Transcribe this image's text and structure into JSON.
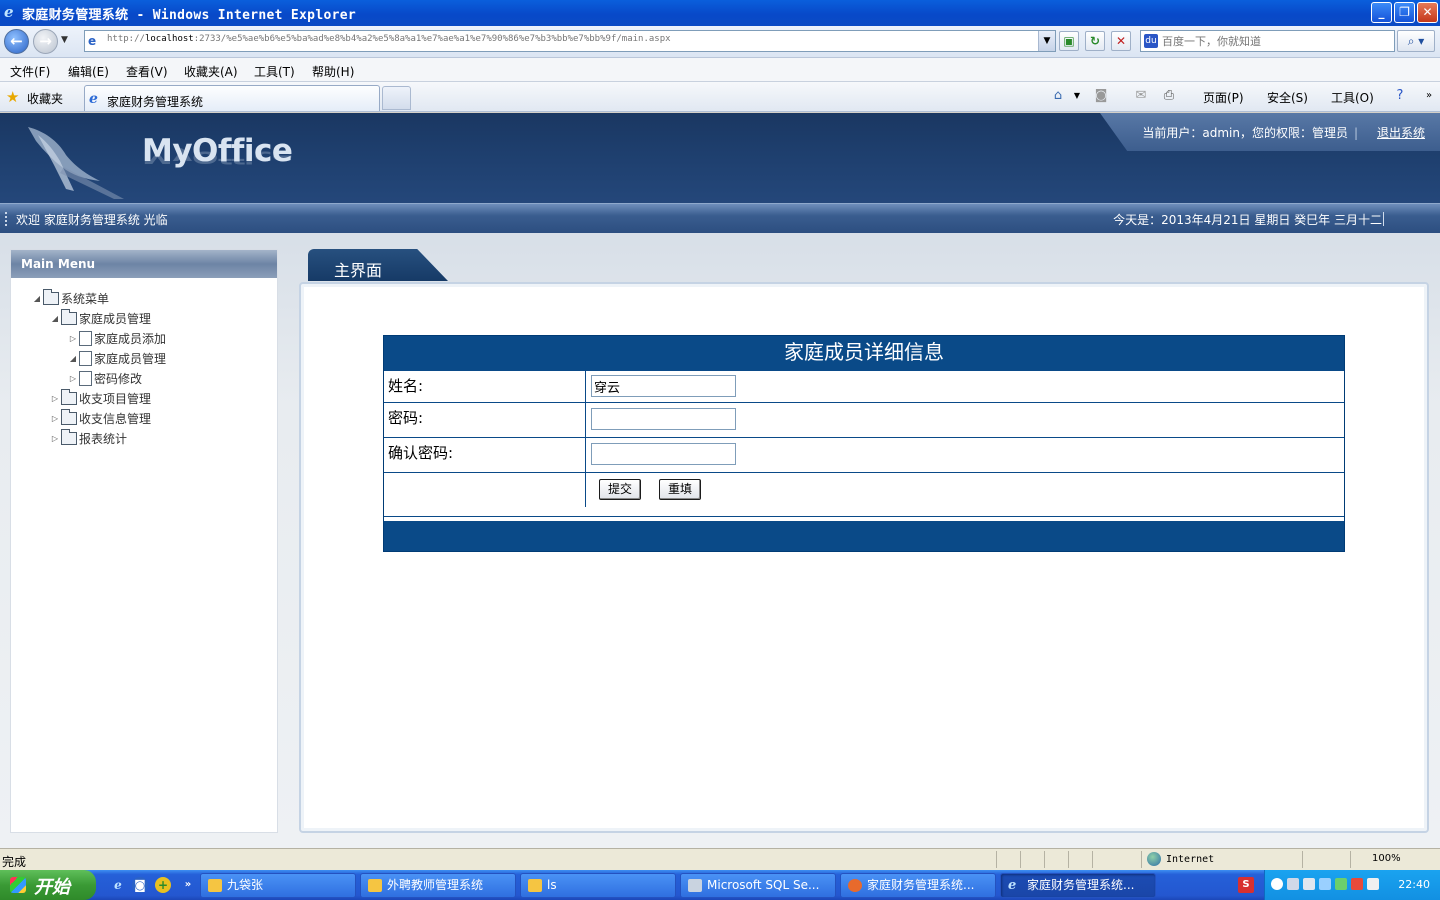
{
  "window": {
    "title": "家庭财务管理系统 - Windows Internet Explorer"
  },
  "browser": {
    "url_prefix": "http://",
    "url_host": "localhost",
    "url_rest": ":2733/%e5%ae%b6%e5%ba%ad%e8%b4%a2%e5%8a%a1%e7%ae%a1%e7%90%86%e7%b3%bb%e7%bb%9f/main.aspx",
    "search_placeholder": "百度一下，你就知道",
    "menu": [
      "文件(F)",
      "编辑(E)",
      "查看(V)",
      "收藏夹(A)",
      "工具(T)",
      "帮助(H)"
    ],
    "favorites_label": "收藏夹",
    "tab_label": "家庭财务管理系统",
    "commands": {
      "page": "页面(P)",
      "safety": "安全(S)",
      "tools": "工具(O)"
    },
    "status_text": "完成",
    "zone": "Internet",
    "zoom": "100%"
  },
  "app": {
    "logo": "MyOffice",
    "user_info": "当前用户：admin，您的权限：管理员",
    "logout": "退出系统",
    "welcome": "欢迎 家庭财务管理系统 光临",
    "today": "今天是：2013年4月21日 星期日 癸巳年 三月十二"
  },
  "sidebar": {
    "title": "Main Menu",
    "root": "系统菜单",
    "nodes": [
      {
        "label": "家庭成员管理",
        "children": [
          "家庭成员添加",
          "家庭成员管理",
          "密码修改"
        ]
      },
      {
        "label": "收支项目管理"
      },
      {
        "label": "收支信息管理"
      },
      {
        "label": "报表统计"
      }
    ]
  },
  "main": {
    "tab_label": "主界面",
    "form": {
      "caption": "家庭成员详细信息",
      "name_label": "姓名:",
      "name_value": "穿云",
      "password_label": "密码:",
      "password_value": "",
      "confirm_label": "确认密码:",
      "confirm_value": "",
      "submit_label": "提交",
      "reset_label": "重填"
    }
  },
  "taskbar": {
    "start": "开始",
    "tasks": [
      "九袋张",
      "外聘教师管理系统",
      "ls",
      "Microsoft SQL Se...",
      "家庭财务管理系统...",
      "家庭财务管理系统..."
    ],
    "clock": "22:40"
  },
  "colors": {
    "header_navy": "#1e3f6e",
    "form_blue": "#0a4a88",
    "xp_blue": "#2457d0"
  }
}
